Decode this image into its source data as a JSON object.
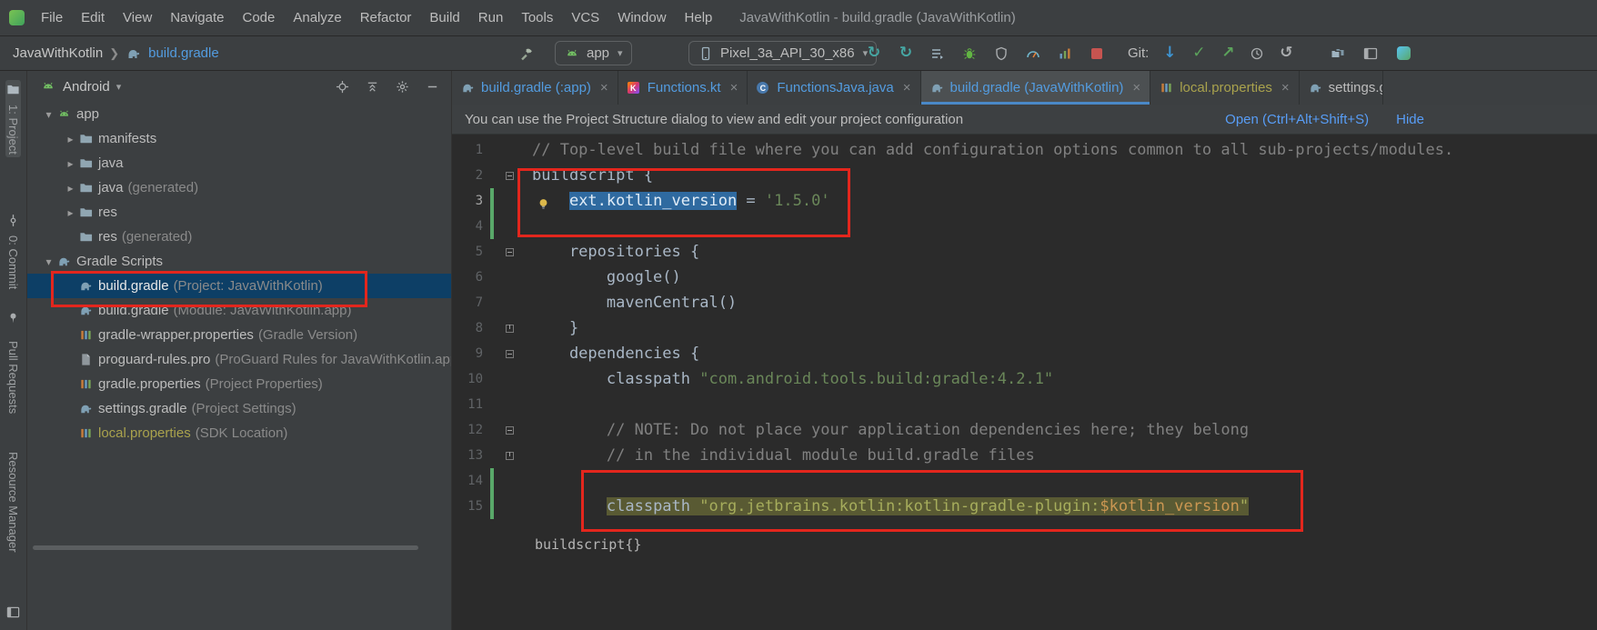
{
  "window": {
    "title": "JavaWithKotlin - build.gradle (JavaWithKotlin)"
  },
  "menubar": {
    "items": [
      "File",
      "Edit",
      "View",
      "Navigate",
      "Code",
      "Analyze",
      "Refactor",
      "Build",
      "Run",
      "Tools",
      "VCS",
      "Window",
      "Help"
    ]
  },
  "toolbar": {
    "breadcrumb": {
      "project": "JavaWithKotlin",
      "file": "build.gradle"
    },
    "run_config": "app",
    "device": "Pixel_3a_API_30_x86",
    "git_label": "Git:",
    "run_icons": [
      "apply-changes-icon",
      "apply-code-changes-icon",
      "attach-debugger-icon",
      "debug-icon",
      "profile-icon",
      "profiler-gauge-icon",
      "profiler-icon",
      "stop-icon"
    ],
    "git_icons": [
      "update-project-icon",
      "commit-check-icon",
      "push-icon",
      "history-clock-icon",
      "rollback-icon"
    ],
    "right_icons": [
      "device-file-explorer-icon",
      "tool-window-layout-icon",
      "gradient-badge-icon"
    ]
  },
  "stripe": {
    "items": [
      {
        "label": "1: Project",
        "icon": "project",
        "active": true
      },
      {
        "label": "0: Commit",
        "icon": "commit"
      },
      {
        "label": "",
        "icon": "pin"
      },
      {
        "label": "Pull Requests",
        "icon": ""
      },
      {
        "label": "Resource Manager",
        "icon": ""
      }
    ]
  },
  "project": {
    "view": "Android",
    "header_icons": [
      "locate-file-icon",
      "collapse-all-icon",
      "settings-gear-icon",
      "hide-panel-icon"
    ],
    "tree": [
      {
        "label": "app",
        "suffix": "",
        "icon": "android",
        "chevron": "down",
        "indent": 0
      },
      {
        "label": "manifests",
        "suffix": "",
        "icon": "folder",
        "chevron": "right",
        "indent": 1
      },
      {
        "label": "java",
        "suffix": "",
        "icon": "folder",
        "chevron": "right",
        "indent": 1
      },
      {
        "label": "java",
        "suffix": "(generated)",
        "icon": "folder",
        "chevron": "right",
        "indent": 1
      },
      {
        "label": "res",
        "suffix": "",
        "icon": "folder",
        "chevron": "right",
        "indent": 1
      },
      {
        "label": "res",
        "suffix": "(generated)",
        "icon": "folder",
        "chevron": "none",
        "indent": 1
      },
      {
        "label": "Gradle Scripts",
        "suffix": "",
        "icon": "gradle",
        "chevron": "down",
        "indent": 0
      },
      {
        "label": "build.gradle",
        "suffix": "(Project: JavaWithKotlin)",
        "icon": "gradle",
        "chevron": "none",
        "indent": 1,
        "selected": true
      },
      {
        "label": "build.gradle",
        "suffix": "(Module: JavaWithKotlin.app)",
        "icon": "gradle",
        "chevron": "none",
        "indent": 1
      },
      {
        "label": "gradle-wrapper.properties",
        "suffix": "(Gradle Version)",
        "icon": "properties",
        "chevron": "none",
        "indent": 1
      },
      {
        "label": "proguard-rules.pro",
        "suffix": "(ProGuard Rules for JavaWithKotlin.app)",
        "icon": "pro",
        "chevron": "none",
        "indent": 1
      },
      {
        "label": "gradle.properties",
        "suffix": "(Project Properties)",
        "icon": "properties",
        "chevron": "none",
        "indent": 1
      },
      {
        "label": "settings.gradle",
        "suffix": "(Project Settings)",
        "icon": "gradle",
        "chevron": "none",
        "indent": 1
      },
      {
        "label": "local.properties",
        "suffix": "(SDK Location)",
        "icon": "properties",
        "chevron": "none",
        "indent": 1,
        "ignored": true
      }
    ]
  },
  "tabs": [
    {
      "label": "build.gradle (:app)",
      "icon": "gradle",
      "state": "modified"
    },
    {
      "label": "Functions.kt",
      "icon": "kotlin",
      "state": "modified"
    },
    {
      "label": "FunctionsJava.java",
      "icon": "java",
      "state": "modified"
    },
    {
      "label": "build.gradle (JavaWithKotlin)",
      "icon": "gradle",
      "state": "modified",
      "active": true
    },
    {
      "label": "local.properties",
      "icon": "properties",
      "state": "ignored"
    },
    {
      "label": "settings.gradle",
      "icon": "gradle",
      "state": "normal",
      "clipped": true
    }
  ],
  "notification": {
    "text": "You can use the Project Structure dialog to view and edit your project configuration",
    "action": "Open (Ctrl+Alt+Shift+S)",
    "dismiss": "Hide"
  },
  "editor": {
    "breadcrumb": "buildscript{}",
    "lines": [
      {
        "n": 1,
        "seg": [
          {
            "t": "// Top-level build file where you can add configuration options common to all sub-projects/modules.",
            "c": "com"
          }
        ]
      },
      {
        "n": 2,
        "fold": "open",
        "seg": [
          {
            "t": "buildscript {",
            "c": "pl"
          }
        ]
      },
      {
        "n": 3,
        "change": true,
        "bulb": true,
        "activeNum": true,
        "seg": [
          {
            "t": "    ",
            "c": "pl"
          },
          {
            "t": "ext.kotlin_version",
            "c": "pl sel"
          },
          {
            "t": " = ",
            "c": "pl"
          },
          {
            "t": "'1.5.0'",
            "c": "str"
          }
        ]
      },
      {
        "n": 4,
        "change": true,
        "seg": []
      },
      {
        "n": 5,
        "fold": "open",
        "seg": [
          {
            "t": "    repositories {",
            "c": "pl"
          }
        ]
      },
      {
        "n": 6,
        "seg": [
          {
            "t": "        google()",
            "c": "pl"
          }
        ]
      },
      {
        "n": 7,
        "seg": [
          {
            "t": "        mavenCentral()",
            "c": "pl"
          }
        ]
      },
      {
        "n": 8,
        "fold": "close",
        "seg": [
          {
            "t": "    }",
            "c": "pl"
          }
        ]
      },
      {
        "n": 9,
        "fold": "open",
        "seg": [
          {
            "t": "    dependencies {",
            "c": "pl"
          }
        ]
      },
      {
        "n": 10,
        "seg": [
          {
            "t": "        classpath ",
            "c": "pl"
          },
          {
            "t": "\"com.android.tools.build:gradle:4.2.1\"",
            "c": "str"
          }
        ]
      },
      {
        "n": 11,
        "seg": []
      },
      {
        "n": 12,
        "fold": "open",
        "seg": [
          {
            "t": "        ",
            "c": "pl"
          },
          {
            "t": "// NOTE: Do not place your application dependencies here; they belong",
            "c": "com"
          }
        ]
      },
      {
        "n": 13,
        "fold": "close",
        "seg": [
          {
            "t": "        ",
            "c": "pl"
          },
          {
            "t": "// in the individual module build.gradle files",
            "c": "com"
          }
        ]
      },
      {
        "n": 14,
        "change": true,
        "seg": []
      },
      {
        "n": 15,
        "change": true,
        "seg": [
          {
            "t": "        ",
            "c": "pl"
          },
          {
            "t": "classpath ",
            "c": "pl hl"
          },
          {
            "t": "\"org.jetbrains.kotlin:kotlin-gradle-plugin:",
            "c": "str hl"
          },
          {
            "t": "$kotlin_version",
            "c": "var hl"
          },
          {
            "t": "\"",
            "c": "str hl"
          }
        ]
      }
    ]
  },
  "colors": {
    "annotation_red": "#e3261d",
    "selection_blue": "#2f6aa0",
    "line_highlight_olive": "#595a33",
    "modified_file_blue": "#539ce0",
    "ignored_file_olive": "#a9a24d",
    "change_marker_green": "#59a869",
    "active_tab_underline": "#4a88c7"
  }
}
